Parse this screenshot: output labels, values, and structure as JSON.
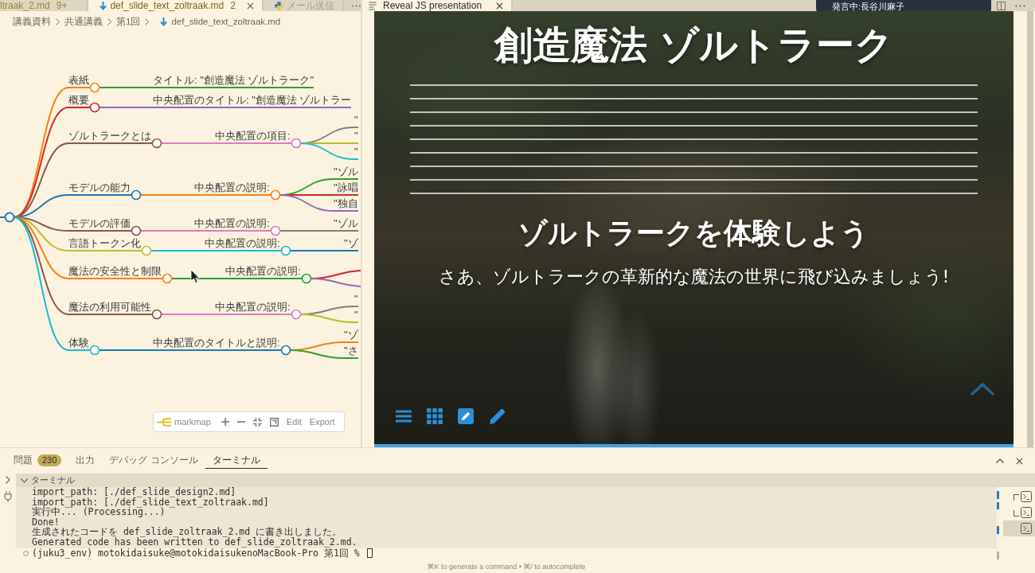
{
  "editor_tabs": [
    {
      "label": "ltraak_2.md",
      "badge": "9+",
      "selected": false
    },
    {
      "label": "def_slide_text_zoltraak.md",
      "badge": "2",
      "kind": "markdown",
      "selected": true
    },
    {
      "label": "メール送信",
      "kind": "python",
      "selected": false
    }
  ],
  "breadcrumb": [
    {
      "label": "講義資料"
    },
    {
      "label": "共通講義"
    },
    {
      "label": "第1回"
    },
    {
      "label": "def_slide_text_zoltraak.md",
      "kind": "markdown"
    }
  ],
  "mindmap": {
    "root": {
      "color": "#1f77b4"
    },
    "branches": [
      {
        "label": "表紙",
        "color": "#ff7f0e",
        "children": [
          {
            "label": "タイトル: \"創造魔法 ゾルトラーク\"",
            "color": "#2ca02c"
          }
        ]
      },
      {
        "label": "概要",
        "color": "#d62728",
        "children": [
          {
            "label": "中央配置のタイトル: \"創造魔法 ゾルトラー",
            "color": "#9467bd"
          }
        ]
      },
      {
        "label": "ゾルトラークとは",
        "color": "#8c564b",
        "children": [
          {
            "label": "中央配置の項目:",
            "color": "#e377c2",
            "children": [
              {
                "label": "\"",
                "color": "#7f7f7f"
              },
              {
                "label": "\"",
                "color": "#bcbd22"
              },
              {
                "label": "\"",
                "color": "#17becf"
              }
            ]
          }
        ]
      },
      {
        "label": "モデルの能力",
        "color": "#1f77b4",
        "children": [
          {
            "label": "中央配置の説明:",
            "color": "#ff7f0e",
            "children": [
              {
                "label": "\"ゾル",
                "color": "#2ca02c"
              },
              {
                "label": "\"詠唱",
                "color": "#d62728"
              },
              {
                "label": "\"独自",
                "color": "#9467bd"
              }
            ]
          }
        ]
      },
      {
        "label": "モデルの評価",
        "color": "#8c564b",
        "children": [
          {
            "label": "中央配置の説明:",
            "color": "#e377c2",
            "children": [
              {
                "label": "\"ゾル",
                "color": "#7f7f7f"
              }
            ]
          }
        ]
      },
      {
        "label": "言語トークン化",
        "color": "#bcbd22",
        "children": [
          {
            "label": "中央配置の説明:",
            "color": "#17becf",
            "children": [
              {
                "label": "\"ゾ",
                "color": "#1f77b4"
              }
            ]
          }
        ]
      },
      {
        "label": "魔法の安全性と制限",
        "color": "#ff7f0e",
        "children": [
          {
            "label": "中央配置の説明:",
            "color": "#2ca02c",
            "children": [
              {
                "color": "#d62728"
              },
              {
                "color": "#9467bd"
              }
            ]
          }
        ]
      },
      {
        "label": "魔法の利用可能性",
        "color": "#8c564b",
        "children": [
          {
            "label": "中央配置の説明:",
            "color": "#e377c2",
            "children": [
              {
                "label": "\"",
                "color": "#7f7f7f"
              },
              {
                "label": "\"",
                "color": "#bcbd22"
              }
            ]
          }
        ]
      },
      {
        "label": "体験",
        "color": "#17becf",
        "children": [
          {
            "label": "中央配置のタイトルと説明:",
            "color": "#1f77b4",
            "children": [
              {
                "label": "\"ゾ",
                "color": "#ff7f0e"
              },
              {
                "label": "\"さ",
                "color": "#2ca02c"
              }
            ]
          }
        ]
      }
    ]
  },
  "markmap_toolbar": {
    "brand": "markmap",
    "buttons": [
      {
        "kind": "zoom-in"
      },
      {
        "kind": "zoom-out"
      },
      {
        "kind": "fit"
      },
      {
        "kind": "minimap"
      },
      {
        "kind": "text",
        "label": "Edit"
      },
      {
        "kind": "text",
        "label": "Export"
      }
    ]
  },
  "preview_tabs": [
    {
      "label": "Reveal JS presentation",
      "kind": "preview",
      "selected": true
    }
  ],
  "speaking_banner": "発言中:長谷川麻子",
  "slide": {
    "title": "創造魔法 ゾルトラーク",
    "heading": "ゾルトラークを体験しよう",
    "subtitle": "さあ、ゾルトラークの革新的な魔法の世界に飛び込みましょう!",
    "progress": {
      "level": 1
    }
  },
  "panel": {
    "tabs": [
      {
        "label": "問題",
        "badge": "230",
        "selected": false
      },
      {
        "label": "出力",
        "selected": false
      },
      {
        "label": "デバッグ コンソール",
        "selected": false
      },
      {
        "label": "ターミナル",
        "selected": true
      }
    ],
    "terminal": {
      "title": "ターミナル",
      "expanded": true,
      "output": [
        "import_path: [./def_slide_design2.md]",
        "import_path: [./def_slide_text_zoltraak.md]",
        "実行中... (Processing...)",
        "Done!",
        "生成されたコードを def_slide_zoltraak_2.md に書き出しました。",
        "Generated code has been written to def_slide_zoltraak_2.md."
      ],
      "prompt": "(juku3_env) motokidaisuke@motokidaisukenoMacBook-Pro 第1回 %",
      "hint": "⌘K to generate a command • ⌘/ to autocomplete",
      "instances": [
        {
          "kind": "group-top",
          "selected": false
        },
        {
          "kind": "group-bottom",
          "selected": false
        },
        {
          "kind": "single",
          "selected": true
        }
      ]
    }
  }
}
